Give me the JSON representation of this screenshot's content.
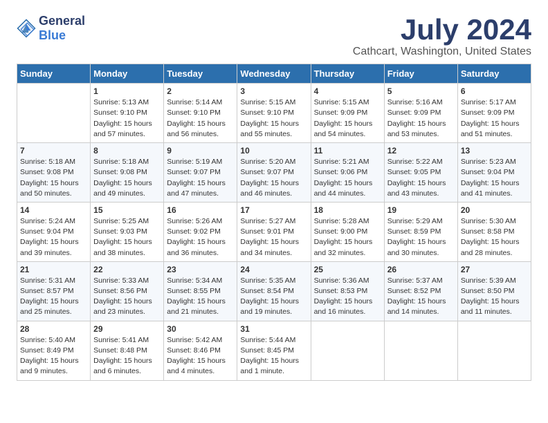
{
  "logo": {
    "text_general": "General",
    "text_blue": "Blue"
  },
  "title": "July 2024",
  "subtitle": "Cathcart, Washington, United States",
  "days_of_week": [
    "Sunday",
    "Monday",
    "Tuesday",
    "Wednesday",
    "Thursday",
    "Friday",
    "Saturday"
  ],
  "weeks": [
    [
      {
        "day": "",
        "info": ""
      },
      {
        "day": "1",
        "info": "Sunrise: 5:13 AM\nSunset: 9:10 PM\nDaylight: 15 hours\nand 57 minutes."
      },
      {
        "day": "2",
        "info": "Sunrise: 5:14 AM\nSunset: 9:10 PM\nDaylight: 15 hours\nand 56 minutes."
      },
      {
        "day": "3",
        "info": "Sunrise: 5:15 AM\nSunset: 9:10 PM\nDaylight: 15 hours\nand 55 minutes."
      },
      {
        "day": "4",
        "info": "Sunrise: 5:15 AM\nSunset: 9:09 PM\nDaylight: 15 hours\nand 54 minutes."
      },
      {
        "day": "5",
        "info": "Sunrise: 5:16 AM\nSunset: 9:09 PM\nDaylight: 15 hours\nand 53 minutes."
      },
      {
        "day": "6",
        "info": "Sunrise: 5:17 AM\nSunset: 9:09 PM\nDaylight: 15 hours\nand 51 minutes."
      }
    ],
    [
      {
        "day": "7",
        "info": "Sunrise: 5:18 AM\nSunset: 9:08 PM\nDaylight: 15 hours\nand 50 minutes."
      },
      {
        "day": "8",
        "info": "Sunrise: 5:18 AM\nSunset: 9:08 PM\nDaylight: 15 hours\nand 49 minutes."
      },
      {
        "day": "9",
        "info": "Sunrise: 5:19 AM\nSunset: 9:07 PM\nDaylight: 15 hours\nand 47 minutes."
      },
      {
        "day": "10",
        "info": "Sunrise: 5:20 AM\nSunset: 9:07 PM\nDaylight: 15 hours\nand 46 minutes."
      },
      {
        "day": "11",
        "info": "Sunrise: 5:21 AM\nSunset: 9:06 PM\nDaylight: 15 hours\nand 44 minutes."
      },
      {
        "day": "12",
        "info": "Sunrise: 5:22 AM\nSunset: 9:05 PM\nDaylight: 15 hours\nand 43 minutes."
      },
      {
        "day": "13",
        "info": "Sunrise: 5:23 AM\nSunset: 9:04 PM\nDaylight: 15 hours\nand 41 minutes."
      }
    ],
    [
      {
        "day": "14",
        "info": "Sunrise: 5:24 AM\nSunset: 9:04 PM\nDaylight: 15 hours\nand 39 minutes."
      },
      {
        "day": "15",
        "info": "Sunrise: 5:25 AM\nSunset: 9:03 PM\nDaylight: 15 hours\nand 38 minutes."
      },
      {
        "day": "16",
        "info": "Sunrise: 5:26 AM\nSunset: 9:02 PM\nDaylight: 15 hours\nand 36 minutes."
      },
      {
        "day": "17",
        "info": "Sunrise: 5:27 AM\nSunset: 9:01 PM\nDaylight: 15 hours\nand 34 minutes."
      },
      {
        "day": "18",
        "info": "Sunrise: 5:28 AM\nSunset: 9:00 PM\nDaylight: 15 hours\nand 32 minutes."
      },
      {
        "day": "19",
        "info": "Sunrise: 5:29 AM\nSunset: 8:59 PM\nDaylight: 15 hours\nand 30 minutes."
      },
      {
        "day": "20",
        "info": "Sunrise: 5:30 AM\nSunset: 8:58 PM\nDaylight: 15 hours\nand 28 minutes."
      }
    ],
    [
      {
        "day": "21",
        "info": "Sunrise: 5:31 AM\nSunset: 8:57 PM\nDaylight: 15 hours\nand 25 minutes."
      },
      {
        "day": "22",
        "info": "Sunrise: 5:33 AM\nSunset: 8:56 PM\nDaylight: 15 hours\nand 23 minutes."
      },
      {
        "day": "23",
        "info": "Sunrise: 5:34 AM\nSunset: 8:55 PM\nDaylight: 15 hours\nand 21 minutes."
      },
      {
        "day": "24",
        "info": "Sunrise: 5:35 AM\nSunset: 8:54 PM\nDaylight: 15 hours\nand 19 minutes."
      },
      {
        "day": "25",
        "info": "Sunrise: 5:36 AM\nSunset: 8:53 PM\nDaylight: 15 hours\nand 16 minutes."
      },
      {
        "day": "26",
        "info": "Sunrise: 5:37 AM\nSunset: 8:52 PM\nDaylight: 15 hours\nand 14 minutes."
      },
      {
        "day": "27",
        "info": "Sunrise: 5:39 AM\nSunset: 8:50 PM\nDaylight: 15 hours\nand 11 minutes."
      }
    ],
    [
      {
        "day": "28",
        "info": "Sunrise: 5:40 AM\nSunset: 8:49 PM\nDaylight: 15 hours\nand 9 minutes."
      },
      {
        "day": "29",
        "info": "Sunrise: 5:41 AM\nSunset: 8:48 PM\nDaylight: 15 hours\nand 6 minutes."
      },
      {
        "day": "30",
        "info": "Sunrise: 5:42 AM\nSunset: 8:46 PM\nDaylight: 15 hours\nand 4 minutes."
      },
      {
        "day": "31",
        "info": "Sunrise: 5:44 AM\nSunset: 8:45 PM\nDaylight: 15 hours\nand 1 minute."
      },
      {
        "day": "",
        "info": ""
      },
      {
        "day": "",
        "info": ""
      },
      {
        "day": "",
        "info": ""
      }
    ]
  ]
}
